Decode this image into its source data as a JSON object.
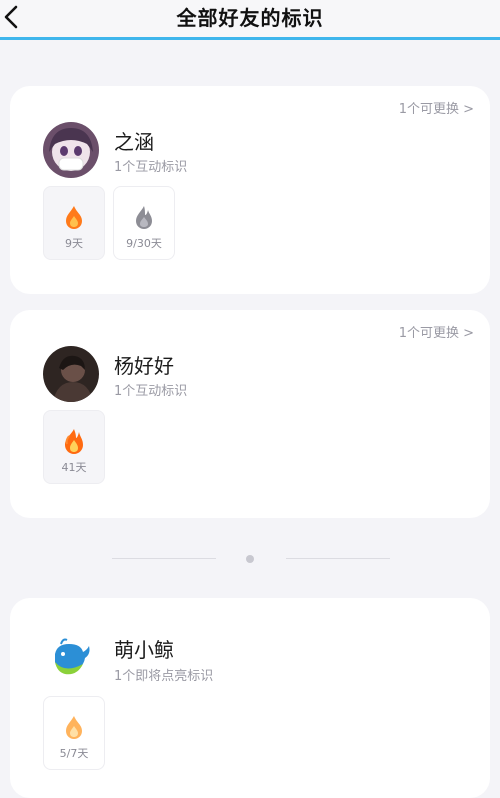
{
  "header": {
    "title": "全部好友的标识"
  },
  "friends": [
    {
      "name": "之涵",
      "subtitle": "1个互动标识",
      "swap_label": "1个可更换 >",
      "badges": [
        {
          "icon": "orange-flame-icon",
          "label": "9天"
        },
        {
          "icon": "gray-flame-icon",
          "label": "9/30天"
        }
      ]
    },
    {
      "name": "杨好好",
      "subtitle": "1个互动标识",
      "swap_label": "1个可更换 >",
      "badges": [
        {
          "icon": "big-flame-icon",
          "label": "41天"
        }
      ]
    },
    {
      "name": "萌小鲸",
      "subtitle": "1个即将点亮标识",
      "badges": [
        {
          "icon": "pale-flame-icon",
          "label": "5/7天"
        }
      ]
    }
  ],
  "colors": {
    "accent": "#3fb6ec",
    "flame": "#ff7a1a",
    "background": "#f4f4f8"
  }
}
